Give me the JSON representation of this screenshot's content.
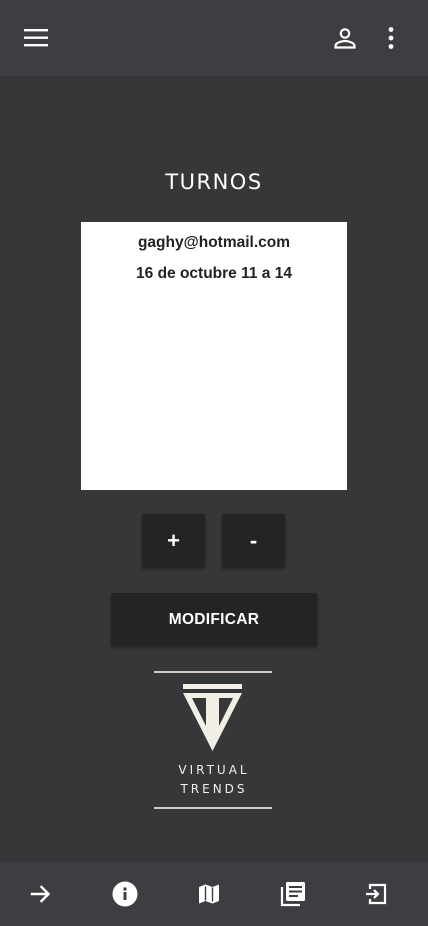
{
  "header": {
    "menu_icon": "menu-icon",
    "account_icon": "account-icon",
    "more_icon": "more-vert-icon"
  },
  "page": {
    "title": "TURNOS"
  },
  "appointment_card": {
    "email": "gaghy@hotmail.com",
    "schedule": "16 de octubre 11 a 14"
  },
  "controls": {
    "plus_label": "+",
    "minus_label": "-",
    "modify_label": "MODIFICAR"
  },
  "logo": {
    "line1": "VIRTUAL",
    "line2": "TRENDS"
  },
  "bottom_nav": {
    "items": [
      {
        "icon": "arrow-forward-icon"
      },
      {
        "icon": "info-icon"
      },
      {
        "icon": "map-icon"
      },
      {
        "icon": "library-books-icon"
      },
      {
        "icon": "exit-icon"
      }
    ]
  },
  "colors": {
    "background": "#363739",
    "bar": "#3d3e41",
    "button": "#232426",
    "card": "#ffffff",
    "text_light": "#ffffff"
  }
}
